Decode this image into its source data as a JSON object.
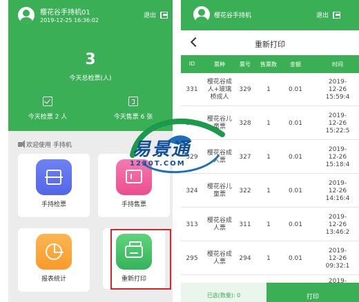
{
  "left_screen": {
    "header": {
      "username": "樱花谷手持机01",
      "datetime": "2019-12-25 16:36:02",
      "logout_label": "退出",
      "total_checked_value": "3",
      "total_checked_label": "今天总检票(人)",
      "today_checked_label": "今天检票 2 人",
      "today_sold_label": "今天售票 6 张"
    },
    "welcome_text": "欢迎使用 手持机",
    "tiles": [
      {
        "label": "手持检票",
        "icon": "scan-icon"
      },
      {
        "label": "手持售票",
        "icon": "ticket-icon"
      },
      {
        "label": "报表统计",
        "icon": "pie-chart-icon"
      },
      {
        "label": "重新打印",
        "icon": "printer-icon"
      }
    ],
    "highlight_color": "#d9232a"
  },
  "right_screen": {
    "header": {
      "title": "樱花谷手持机",
      "logout_label": "退出"
    },
    "page_title": "重新打印",
    "columns": [
      "ID",
      "票种",
      "票号",
      "售票数",
      "金额",
      "时间"
    ],
    "rows": [
      {
        "id": "331",
        "type": "樱花谷成\n人+玻璃\n桥成人",
        "ticket_no": "329",
        "count": "1",
        "amount": "0.01",
        "time": "2019-\n12-26\n15:59:4"
      },
      {
        "id": "330",
        "type": "樱花谷儿\n童票",
        "ticket_no": "328",
        "count": "1",
        "amount": "0.01",
        "time": "2019-\n12-26\n15:22:5"
      },
      {
        "id": "329",
        "type": "樱花谷成\n人票",
        "ticket_no": "327",
        "count": "1",
        "amount": "0.01",
        "time": "2019-\n12-26\n15:18:4"
      },
      {
        "id": "324",
        "type": "樱花谷儿\n童票",
        "ticket_no": "322",
        "count": "1",
        "amount": "0.01",
        "time": "2019-\n12-26\n14:16:4"
      },
      {
        "id": "313",
        "type": "樱花谷成\n人票",
        "ticket_no": "311",
        "count": "1",
        "amount": "0.01",
        "time": "2019-\n12-26\n13:46:2"
      },
      {
        "id": "295",
        "type": "樱花谷成\n人票",
        "ticket_no": "294",
        "count": "1",
        "amount": "0.01",
        "time": "2019-\n12-26\n09:32:1"
      }
    ],
    "partial_row_time": "2019-",
    "footer": {
      "selected_label": "已选(数量): 0",
      "print_label": "打印"
    },
    "accent_color": "#3aaf55"
  },
  "watermark": {
    "brand": "易景通",
    "url": "1230T.COM"
  }
}
